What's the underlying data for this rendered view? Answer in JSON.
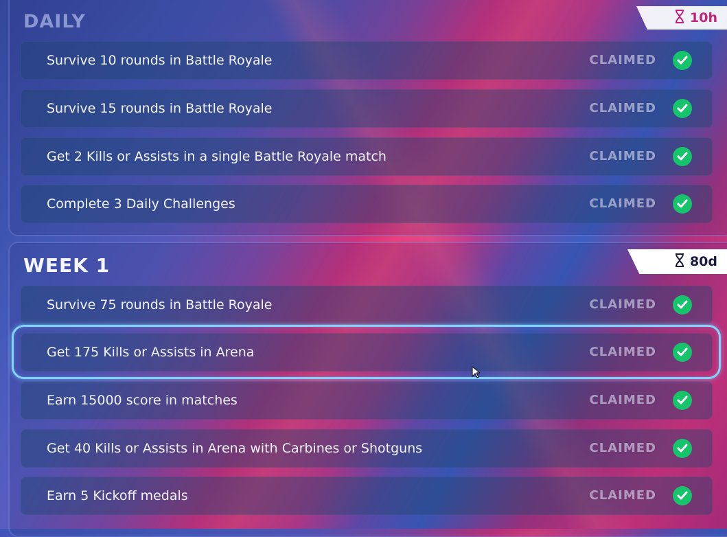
{
  "daily": {
    "title": "DAILY",
    "timer": "10h",
    "challenges": [
      {
        "text": "Survive 10 rounds in Battle Royale",
        "status": "CLAIMED"
      },
      {
        "text": "Survive 15 rounds in Battle Royale",
        "status": "CLAIMED"
      },
      {
        "text": "Get 2 Kills or Assists in a single Battle Royale match",
        "status": "CLAIMED"
      },
      {
        "text": "Complete 3 Daily Challenges",
        "status": "CLAIMED"
      }
    ]
  },
  "week": {
    "title": "WEEK 1",
    "timer": "80d",
    "challenges": [
      {
        "text": "Survive 75 rounds in Battle Royale",
        "status": "CLAIMED"
      },
      {
        "text": "Get 175 Kills or Assists in Arena",
        "status": "CLAIMED"
      },
      {
        "text": "Earn 15000 score in matches",
        "status": "CLAIMED"
      },
      {
        "text": "Get 40 Kills or Assists in Arena with Carbines or Shotguns",
        "status": "CLAIMED"
      },
      {
        "text": "Earn 5 Kickoff medals",
        "status": "CLAIMED"
      }
    ]
  },
  "colors": {
    "check_green": "#16c56b",
    "highlight": "#7fd3ff",
    "claimed_text": "#d7d7eb"
  },
  "icons": {
    "timer": "hourglass-icon",
    "claimed": "checkmark-circle-icon"
  }
}
